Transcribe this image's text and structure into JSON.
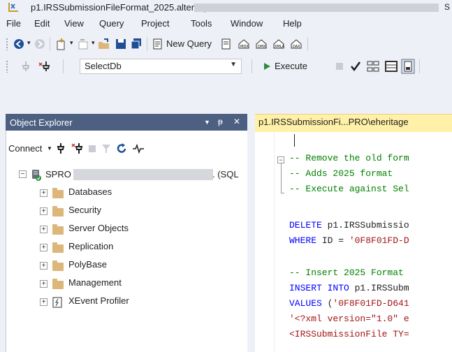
{
  "window": {
    "title": "p1.IRSSubmissionFileFormat_2025.alter.sql",
    "title_edge": "S"
  },
  "menu": [
    "File",
    "Edit",
    "View",
    "Query",
    "Project",
    "Tools",
    "Window",
    "Help"
  ],
  "toolbar1": {
    "new_query": "New Query"
  },
  "toolbar2": {
    "database": "SelectDb",
    "execute": "Execute"
  },
  "object_explorer": {
    "title": "Object Explorer",
    "pin": "↓",
    "close": "✕",
    "connect": "Connect",
    "server_prefix": "SPRO",
    "server_suffix": ". (SQL",
    "nodes": [
      "Databases",
      "Security",
      "Server Objects",
      "Replication",
      "PolyBase",
      "Management",
      "XEvent Profiler"
    ]
  },
  "editor": {
    "tab_title": "p1.IRSSubmissionFi...PRO\\eheritage",
    "lines": [
      {
        "cls": "cm",
        "text": "-- Remove the old form"
      },
      {
        "cls": "cm",
        "text": "-- Adds 2025 format"
      },
      {
        "cls": "cm",
        "text": "-- Execute against Sel"
      },
      {
        "cls": "plain",
        "text": ""
      },
      {
        "cls": "kw",
        "text": "DELETE",
        "rest": " p1.IRSSubmissio"
      },
      {
        "cls": "kw",
        "text": "WHERE",
        "rest": " ID = ",
        "str": "'0F8F01FD-D"
      },
      {
        "cls": "plain",
        "text": ""
      },
      {
        "cls": "cm",
        "text": "-- Insert 2025 Format"
      },
      {
        "cls": "kw",
        "text": "INSERT INTO",
        "rest": " p1.IRSSubm"
      },
      {
        "cls": "kw",
        "text": "VALUES",
        "rest": " (",
        "str": "'0F8F01FD-D641"
      },
      {
        "cls": "str",
        "text": "'<?xml version=\"1.0\" e"
      },
      {
        "cls": "str",
        "text": "<IRSSubmissionFile TY="
      }
    ]
  },
  "colors": {
    "accent_header": "#4d6082",
    "tab_active": "#fff1a8",
    "comment": "#008000",
    "keyword": "#0000ff",
    "string": "#a31515"
  }
}
